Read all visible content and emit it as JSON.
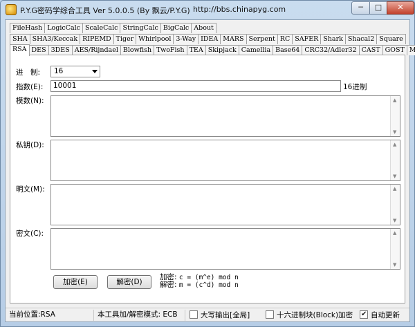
{
  "window": {
    "title": "P.Y.G密码学综合工具 Ver 5.0.0.5 (By 飘云/P.Y.G)",
    "url": "http://bbs.chinapyg.com",
    "min_label": "─",
    "max_label": "□",
    "close_label": "✕"
  },
  "tabs": {
    "row1": [
      "FileHash",
      "LogicCalc",
      "ScaleCalc",
      "StringCalc",
      "BigCalc",
      "About"
    ],
    "row2": [
      "SHA",
      "SHA3/Keccak",
      "RIPEMD",
      "Tiger",
      "Whirlpool",
      "3-Way",
      "IDEA",
      "MARS",
      "Serpent",
      "RC",
      "SAFER",
      "Shark",
      "Shacal2",
      "Square"
    ],
    "row3": [
      "RSA",
      "DES",
      "3DES",
      "AES/Rijndael",
      "Blowfish",
      "TwoFish",
      "TEA",
      "Skipjack",
      "Camellia",
      "Base64",
      "CRC32/Adler32",
      "CAST",
      "GOST",
      "MD"
    ],
    "active": "RSA"
  },
  "rsa": {
    "radix_label": "进　制:",
    "radix_value": "16",
    "exponent_label": "指数(E):",
    "exponent_value": "10001",
    "exponent_suffix": "16进制",
    "modulus_label": "模数(N):",
    "private_label": "私钥(D):",
    "plaintext_label": "明文(M):",
    "ciphertext_label": "密文(C):",
    "encrypt_button": "加密(E)",
    "decrypt_button": "解密(D)",
    "enc_formula_prefix": "加密:",
    "enc_formula": "c = (m^e) mod n",
    "dec_formula_prefix": "解密:",
    "dec_formula": "m = (c^d) mod n"
  },
  "status": {
    "position": "当前位置:RSA",
    "mode": "本工具加/解密模式: ECB",
    "uppercase_label": "大写输出[全局]",
    "uppercase_checked": false,
    "hex_label": "十六进制块(Block)加密",
    "hex_checked": false,
    "autoupdate_label": "自动更新",
    "autoupdate_checked": true
  }
}
